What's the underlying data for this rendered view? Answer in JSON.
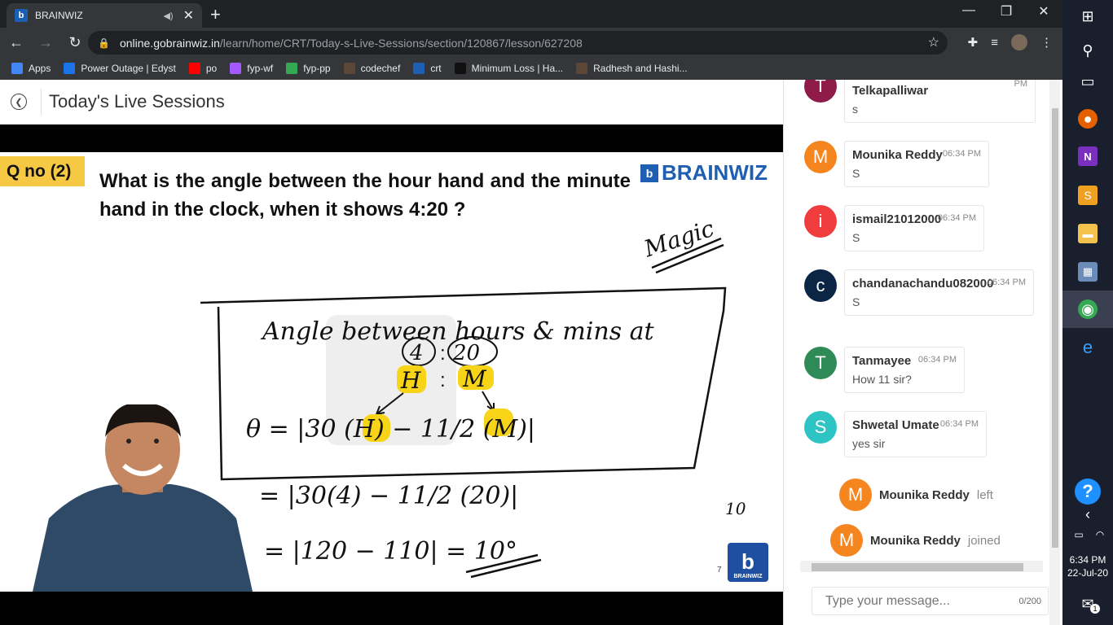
{
  "browser": {
    "tab_title": "BRAINWIZ",
    "url_host": "online.gobrainwiz.in",
    "url_path": "/learn/home/CRT/Today-s-Live-Sessions/section/120867/lesson/627208",
    "bookmarks": [
      {
        "label": "Apps",
        "color": "#4285f4"
      },
      {
        "label": "Power Outage | Edyst",
        "color": "#1a73e8"
      },
      {
        "label": "po",
        "color": "#ff0000"
      },
      {
        "label": "fyp-wf",
        "color": "#a259ff"
      },
      {
        "label": "fyp-pp",
        "color": "#34a853"
      },
      {
        "label": "codechef",
        "color": "#5b4638"
      },
      {
        "label": "crt",
        "color": "#1e5fb4"
      },
      {
        "label": "Minimum Loss | Ha...",
        "color": "#111111"
      },
      {
        "label": "Radhesh and Hashi...",
        "color": "#5b4638"
      }
    ]
  },
  "page": {
    "title": "Today's Live Sessions"
  },
  "slide": {
    "qno": "Q no (2)",
    "question": "What is the angle between the hour hand and the minute hand  in the clock, when it shows 4:20 ?",
    "brand": "BRAINWIZ",
    "page_number": "7",
    "logo_text": "BRAINWIZ",
    "handwriting": {
      "magic": "Magic",
      "line1": "Angle between hours & mins at",
      "time_h": "4",
      "time_m": "20",
      "h": "H",
      "m": "M",
      "formula": "θ = |30 (H) − 11/2 (M)|",
      "step1": "= |30(4) − 11/2 (20)|",
      "step2": "= |120 − 110| = 10°",
      "ten": "10"
    }
  },
  "chat": {
    "messages": [
      {
        "initial": "T",
        "color": "#8e1b4a",
        "name": "Telkapalliwar",
        "time": "PM",
        "text": "s"
      },
      {
        "initial": "M",
        "color": "#f5851f",
        "name": "Mounika Reddy",
        "time": "06:34 PM",
        "text": "S"
      },
      {
        "initial": "i",
        "color": "#f03c3c",
        "name": "ismail21012000",
        "time": "06:34 PM",
        "text": "S"
      },
      {
        "initial": "c",
        "color": "#0b2545",
        "name": "chandanachandu082000",
        "time": "06:34 PM",
        "text": "S"
      },
      {
        "initial": "T",
        "color": "#2e8b57",
        "name": "Tanmayee",
        "time": "06:34 PM",
        "text": "How 11 sir?"
      },
      {
        "initial": "S",
        "color": "#2ec4c4",
        "name": "Shwetal Umate",
        "time": "06:34 PM",
        "text": "yes sir"
      }
    ],
    "system": [
      {
        "initial": "M",
        "color": "#f5851f",
        "name": "Mounika Reddy",
        "action": "left"
      },
      {
        "initial": "M",
        "color": "#f5851f",
        "name": "Mounika Reddy",
        "action": "joined"
      }
    ],
    "input_placeholder": "Type your message...",
    "counter": "0/200"
  },
  "taskbar": {
    "time": "6:34 PM",
    "date": "22-Jul-20",
    "notification_count": "1"
  }
}
